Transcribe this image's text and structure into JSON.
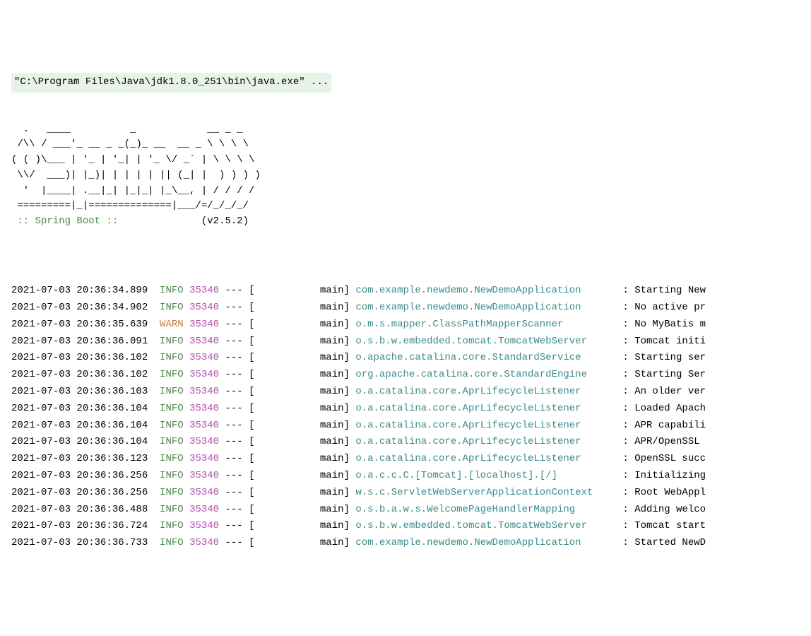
{
  "command_line": "\"C:\\Program Files\\Java\\jdk1.8.0_251\\bin\\java.exe\" ...",
  "banner_lines": [
    "  .   ____          _            __ _ _",
    " /\\\\ / ___'_ __ _ _(_)_ __  __ _ \\ \\ \\ \\",
    "( ( )\\___ | '_ | '_| | '_ \\/ _` | \\ \\ \\ \\",
    " \\\\/  ___)| |_)| | | | | || (_| |  ) ) ) )",
    "  '  |____| .__|_| |_|_| |_\\__, | / / / /",
    " =========|_|==============|___/=/_/_/_/"
  ],
  "spring_boot_label": " :: Spring Boot :: ",
  "spring_boot_version": "(v2.5.2)",
  "log_entries": [
    {
      "ts": "2021-07-03 20:36:34.899",
      "level": "INFO",
      "pid": "35340",
      "thread": "main",
      "logger": "com.example.newdemo.NewDemoApplication      ",
      "msg": "Starting New"
    },
    {
      "ts": "2021-07-03 20:36:34.902",
      "level": "INFO",
      "pid": "35340",
      "thread": "main",
      "logger": "com.example.newdemo.NewDemoApplication      ",
      "msg": "No active pr"
    },
    {
      "ts": "2021-07-03 20:36:35.639",
      "level": "WARN",
      "pid": "35340",
      "thread": "main",
      "logger": "o.m.s.mapper.ClassPathMapperScanner         ",
      "msg": "No MyBatis m"
    },
    {
      "ts": "2021-07-03 20:36:36.091",
      "level": "INFO",
      "pid": "35340",
      "thread": "main",
      "logger": "o.s.b.w.embedded.tomcat.TomcatWebServer     ",
      "msg": "Tomcat initi"
    },
    {
      "ts": "2021-07-03 20:36:36.102",
      "level": "INFO",
      "pid": "35340",
      "thread": "main",
      "logger": "o.apache.catalina.core.StandardService      ",
      "msg": "Starting ser"
    },
    {
      "ts": "2021-07-03 20:36:36.102",
      "level": "INFO",
      "pid": "35340",
      "thread": "main",
      "logger": "org.apache.catalina.core.StandardEngine     ",
      "msg": "Starting Ser"
    },
    {
      "ts": "2021-07-03 20:36:36.103",
      "level": "INFO",
      "pid": "35340",
      "thread": "main",
      "logger": "o.a.catalina.core.AprLifecycleListener      ",
      "msg": "An older ver"
    },
    {
      "ts": "2021-07-03 20:36:36.104",
      "level": "INFO",
      "pid": "35340",
      "thread": "main",
      "logger": "o.a.catalina.core.AprLifecycleListener      ",
      "msg": "Loaded Apach"
    },
    {
      "ts": "2021-07-03 20:36:36.104",
      "level": "INFO",
      "pid": "35340",
      "thread": "main",
      "logger": "o.a.catalina.core.AprLifecycleListener      ",
      "msg": "APR capabili"
    },
    {
      "ts": "2021-07-03 20:36:36.104",
      "level": "INFO",
      "pid": "35340",
      "thread": "main",
      "logger": "o.a.catalina.core.AprLifecycleListener      ",
      "msg": "APR/OpenSSL "
    },
    {
      "ts": "2021-07-03 20:36:36.123",
      "level": "INFO",
      "pid": "35340",
      "thread": "main",
      "logger": "o.a.catalina.core.AprLifecycleListener      ",
      "msg": "OpenSSL succ"
    },
    {
      "ts": "2021-07-03 20:36:36.256",
      "level": "INFO",
      "pid": "35340",
      "thread": "main",
      "logger": "o.a.c.c.C.[Tomcat].[localhost].[/]          ",
      "msg": "Initializing"
    },
    {
      "ts": "2021-07-03 20:36:36.256",
      "level": "INFO",
      "pid": "35340",
      "thread": "main",
      "logger": "w.s.c.ServletWebServerApplicationContext    ",
      "msg": "Root WebAppl"
    },
    {
      "ts": "2021-07-03 20:36:36.488",
      "level": "INFO",
      "pid": "35340",
      "thread": "main",
      "logger": "o.s.b.a.w.s.WelcomePageHandlerMapping       ",
      "msg": "Adding welco"
    },
    {
      "ts": "2021-07-03 20:36:36.724",
      "level": "INFO",
      "pid": "35340",
      "thread": "main",
      "logger": "o.s.b.w.embedded.tomcat.TomcatWebServer     ",
      "msg": "Tomcat start"
    },
    {
      "ts": "2021-07-03 20:36:36.733",
      "level": "INFO",
      "pid": "35340",
      "thread": "main",
      "logger": "com.example.newdemo.NewDemoApplication      ",
      "msg": "Started NewD"
    }
  ]
}
